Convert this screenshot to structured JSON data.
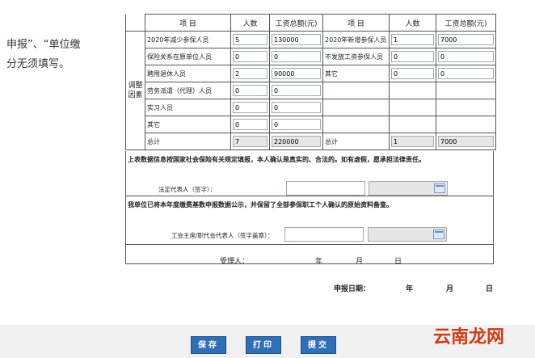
{
  "left_note": [
    "申报”、“单位缴",
    "分无须填写。"
  ],
  "table": {
    "headers": [
      "项 目",
      "人数",
      "工资总额(元)",
      "项 目",
      "人数",
      "工资总额(元)"
    ],
    "factor_label": [
      "调整",
      "因素"
    ],
    "rows": [
      {
        "l_label": "2020年减少参保人员",
        "l_count": "5",
        "l_wage": "130000",
        "r_label": "2020年新增参保人员",
        "r_count": "1",
        "r_wage": "7000"
      },
      {
        "l_label": "保险关系在原单位人员",
        "l_count": "0",
        "l_wage": "0",
        "r_label": "不发放工资参保人员",
        "r_count": "0",
        "r_wage": "0"
      },
      {
        "l_label": "聘用退休人员",
        "l_count": "2",
        "l_wage": "90000",
        "r_label": "其它",
        "r_count": "0",
        "r_wage": "0"
      },
      {
        "l_label": "劳务派遣（代理）人员",
        "l_count": "0",
        "l_wage": "0"
      },
      {
        "l_label": "实习人员",
        "l_count": "0",
        "l_wage": "0"
      },
      {
        "l_label": "其它",
        "l_count": "0",
        "l_wage": "0"
      }
    ],
    "total": {
      "l_label": "总计",
      "l_count": "7",
      "l_wage": "220000",
      "r_label": "总计",
      "r_count": "1",
      "r_wage": "7000"
    }
  },
  "declaration1": "上表数据信息按国家社会保险有关规定填报，本人确认是真实的、合法的。如有虚假，愿承担法律责任。",
  "legal_rep_label": "法定代表人（签字）：",
  "declaration2": "我单位已将本年度缴费基数申报数据公示，并保留了全部参保职工个人确认的原始资料备查。",
  "union_label": "工会主席/职代会代表人（签字盖章）：",
  "receiver": {
    "label": "受理人：",
    "year": "年",
    "month": "月",
    "day": "日"
  },
  "report_date": {
    "label": "申报日期：",
    "year": "年",
    "month": "月",
    "day": "日"
  },
  "buttons": {
    "save": "保存",
    "print": "打印",
    "submit": "提交"
  },
  "watermark": "云南龙网"
}
